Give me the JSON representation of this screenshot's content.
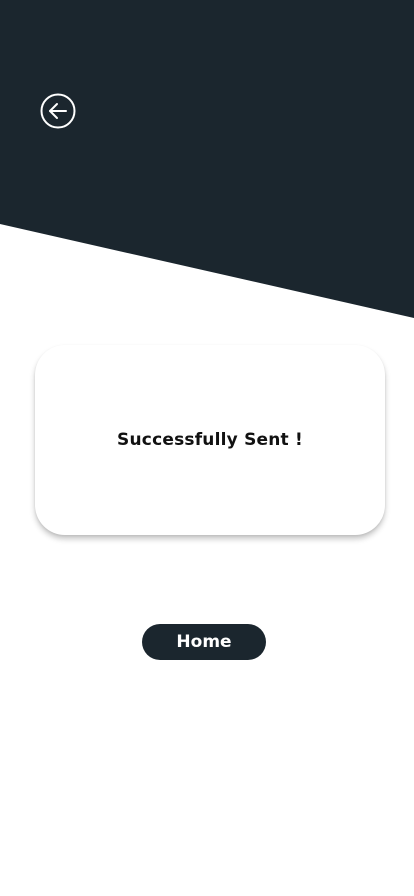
{
  "colors": {
    "primary": "#1b262e",
    "background": "#ffffff",
    "text": "#111111",
    "button_text": "#ffffff"
  },
  "header": {
    "back_icon": "arrow-left-circle-icon"
  },
  "card": {
    "message": "Successfully Sent !"
  },
  "actions": {
    "home_label": "Home"
  }
}
